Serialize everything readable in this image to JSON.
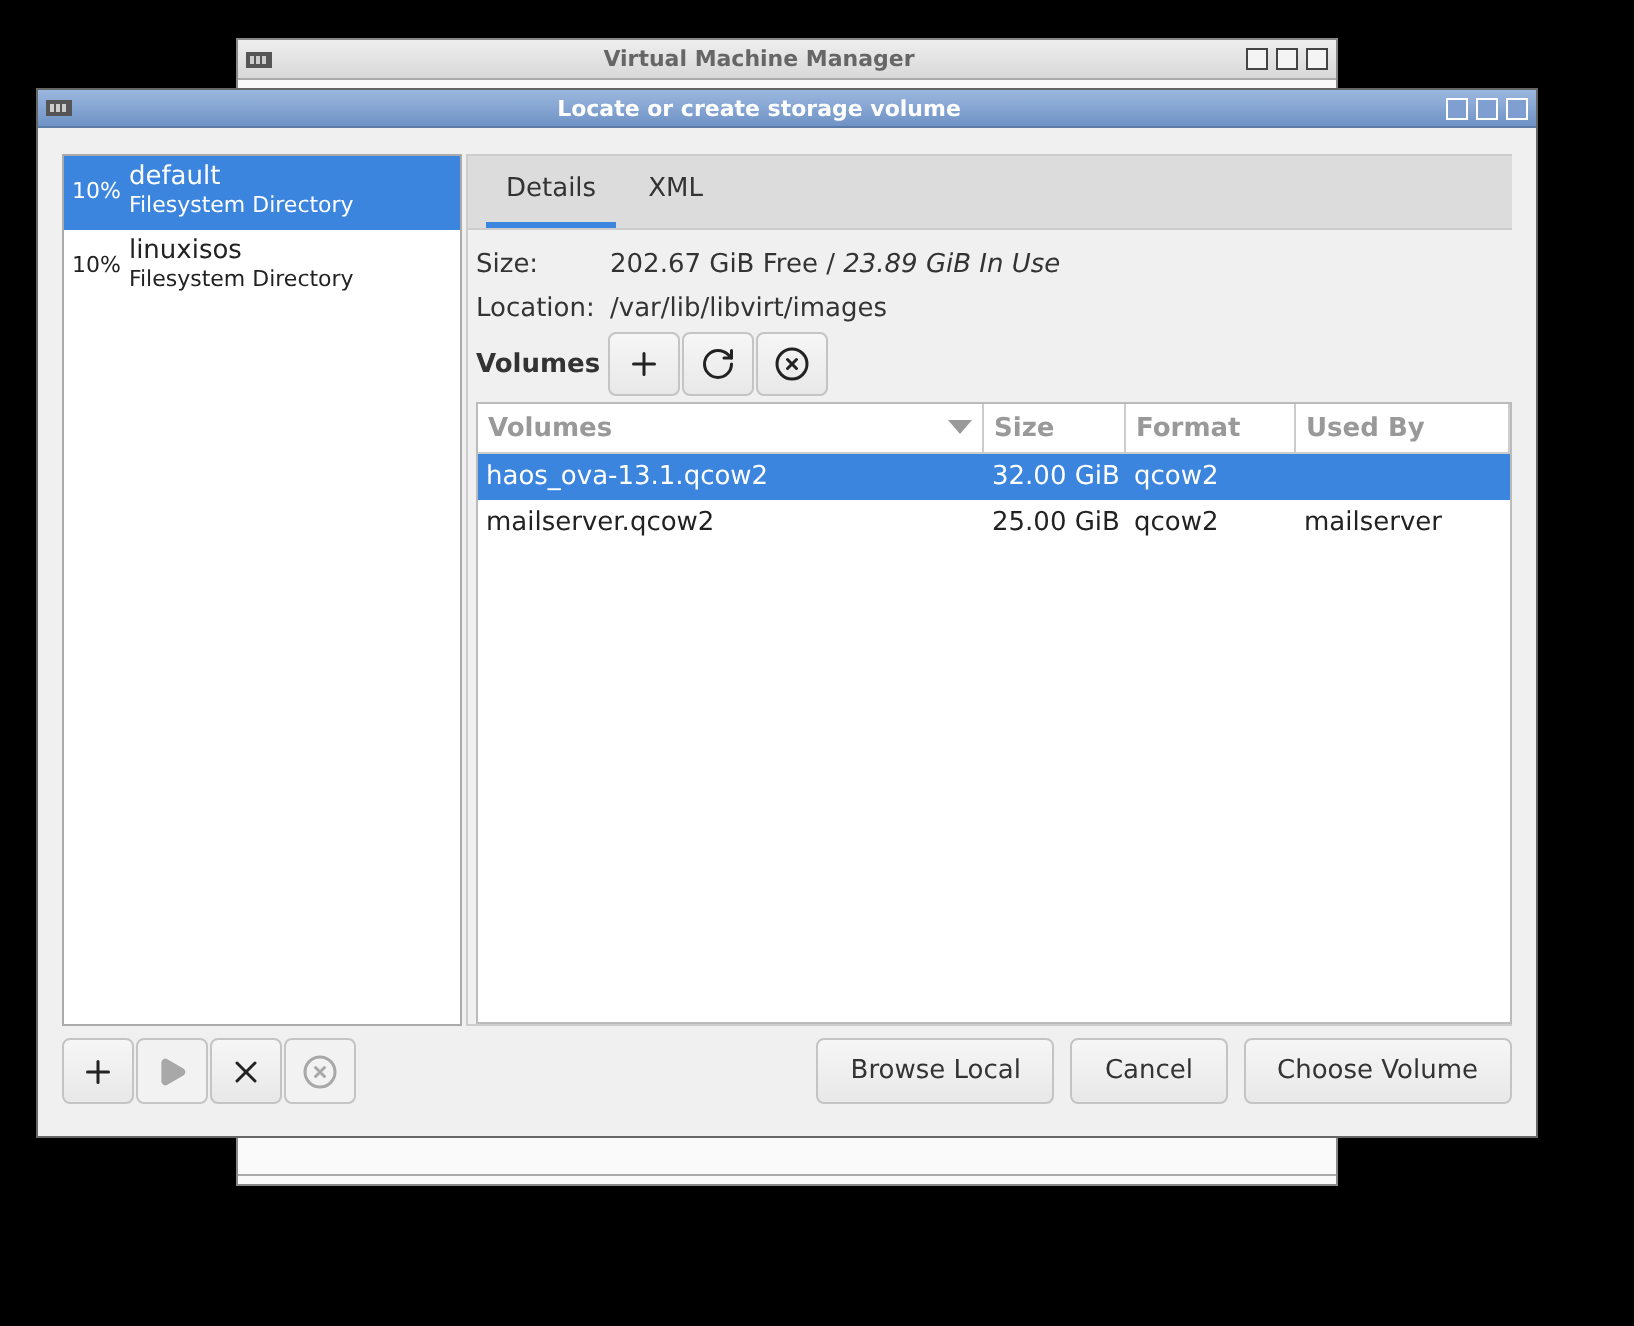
{
  "background_window": {
    "title": "Virtual Machine Manager"
  },
  "dialog": {
    "title": "Locate or create storage volume"
  },
  "pools": [
    {
      "percent": "10%",
      "name": "default",
      "type": "Filesystem Directory",
      "selected": true
    },
    {
      "percent": "10%",
      "name": "linuxisos",
      "type": "Filesystem Directory",
      "selected": false
    }
  ],
  "tabs": [
    {
      "label": "Details",
      "selected": true
    },
    {
      "label": "XML",
      "selected": false
    }
  ],
  "details": {
    "size_label": "Size:",
    "size_value": "202.67 GiB Free / *23.89 GiB In Use*",
    "location_label": "Location:",
    "location_value": "/var/lib/libvirt/images"
  },
  "volumes_label": "Volumes",
  "volume_buttons": [
    {
      "kind": "add",
      "disabled": false
    },
    {
      "kind": "refresh",
      "disabled": false
    },
    {
      "kind": "delete",
      "disabled": false
    }
  ],
  "table": {
    "columns": [
      "Volumes",
      "Size",
      "Format",
      "Used By"
    ],
    "rows": [
      {
        "cells": [
          "haos_ova-13.1.qcow2",
          "32.00 GiB",
          "qcow2",
          ""
        ],
        "selected": true
      },
      {
        "cells": [
          "mailserver.qcow2",
          "25.00 GiB",
          "qcow2",
          "mailserver"
        ],
        "selected": false
      }
    ]
  },
  "pool_buttons": [
    {
      "kind": "add",
      "disabled": false
    },
    {
      "kind": "start",
      "disabled": true
    },
    {
      "kind": "stop",
      "disabled": false
    },
    {
      "kind": "delete",
      "disabled": true
    }
  ],
  "buttons": [
    "Browse Local",
    "Cancel",
    "Choose Volume"
  ]
}
